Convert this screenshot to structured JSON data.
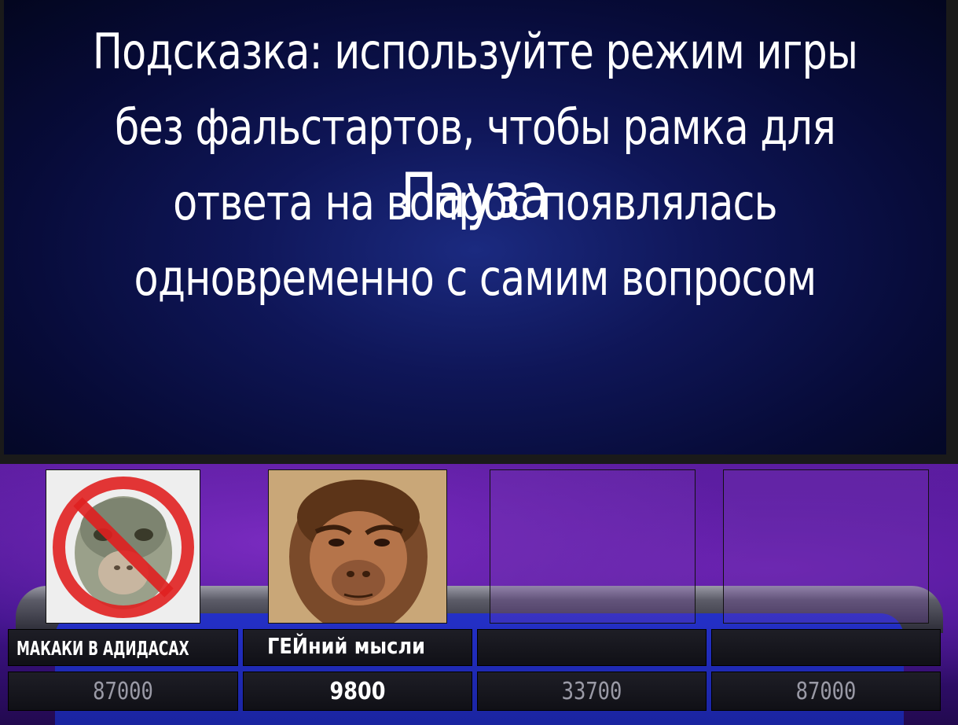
{
  "board": {
    "hint_lines": [
      "Подсказка: используйте режим игры",
      "без фальстартов, чтобы рамка для",
      "ответа на вопрос появлялась",
      "одновременно с самим вопросом"
    ],
    "pause_label": "Пауза"
  },
  "players": [
    {
      "name": "МАКАКИ В АДИДАСАХ",
      "score": "87000",
      "avatar": "crossed-out-monkey",
      "active": false
    },
    {
      "name": "ГЕЙний мысли",
      "score": "9800",
      "avatar": "ape-face",
      "active": true
    },
    {
      "name": "",
      "score": "33700",
      "avatar": "none",
      "active": false
    },
    {
      "name": "",
      "score": "87000",
      "avatar": "none",
      "active": false
    }
  ],
  "colors": {
    "board_center": "#1b2a80",
    "board_edge": "#03061f",
    "stage_purple": "#5a1c9e",
    "floor_blue": "#2430c8",
    "score_dim": "#9a9aa6",
    "prohibition_red": "#e02020"
  }
}
